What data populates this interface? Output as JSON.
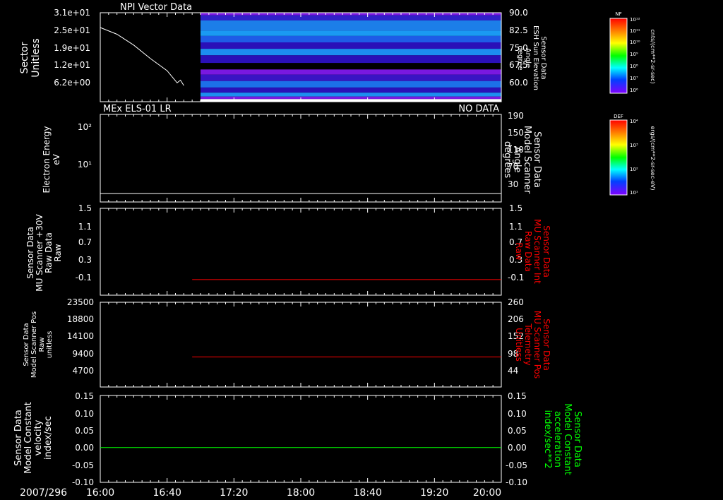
{
  "colors": {
    "background": "#000000",
    "frame": "#ffffff",
    "red": "#ff0000",
    "green": "#00ff00",
    "spectrogram_dark": "#2a10b8",
    "spectrogram_purple": "#7a18e0",
    "spectrogram_mid": "#1e46e6",
    "spectrogram_bright": "#1c8ef0"
  },
  "time_axis": {
    "date_label": "2007/296",
    "tick_labels": [
      "16:00",
      "16:40",
      "17:20",
      "18:00",
      "18:40",
      "19:20",
      "20:00"
    ]
  },
  "chart_data": [
    {
      "type": "line",
      "panel_title": "NPI Vector Data",
      "ylabel_lines": [
        "Sector",
        "Unitless"
      ],
      "right_label_lines": [
        "Sensor Data",
        "ESH Sun Elevation",
        "Angle",
        "degree"
      ],
      "y_tick_labels": [
        "3.1e+01",
        "2.5e+01",
        "1.9e+01",
        "1.2e+01",
        "6.2e+00"
      ],
      "right_tick_labels": [
        "90.0",
        "82.5",
        "75.0",
        "67.5",
        "60.0"
      ],
      "x": [
        "16:00",
        "16:10",
        "16:20",
        "16:30",
        "16:40",
        "16:46",
        "16:48",
        "16:50"
      ],
      "series": [
        {
          "values": [
            27.5,
            25.0,
            21.0,
            16.0,
            11.5,
            7.0,
            8.0,
            6.0
          ]
        }
      ],
      "overlay": {
        "type": "heatmap",
        "time_start": "17:00",
        "time_end": "20:00",
        "yrange_degrees": [
          55.5,
          90.0
        ]
      },
      "colorbar": {
        "label": "NF",
        "tick_labels": [
          "10¹²",
          "10¹¹",
          "10¹⁰",
          "10⁹",
          "10⁸",
          "10⁷",
          "10⁶"
        ],
        "unit": "cnts/(cm**2-sr-sec)"
      }
    },
    {
      "type": "line",
      "panel_title": "MEx ELS-01 LR",
      "status": "NO DATA",
      "ylabel_lines": [
        "Electron Energy",
        "eV"
      ],
      "right_label_lines": [
        "Sensor Data",
        "Model Scanner",
        "Angle",
        "degrees"
      ],
      "y_tick_labels": [
        "10²",
        "10¹"
      ],
      "right_tick_labels": [
        "190",
        "150",
        "110",
        "70",
        "30"
      ],
      "x": [
        "16:00",
        "20:00"
      ],
      "series": [
        {
          "values": [
            15,
            15
          ]
        }
      ],
      "ylim": [
        10,
        190
      ],
      "colorbar": {
        "label": "DEF",
        "tick_labels": [
          "10⁴",
          "10³",
          "10²",
          "10¹"
        ],
        "unit": "ergs/(cm**2-sr-sec-eV)"
      }
    },
    {
      "type": "line",
      "ylabel_lines": [
        "Sensor Data",
        "MU Scanner +30V",
        "Raw Data",
        "Raw"
      ],
      "right_label_lines": [
        "Sensor Data",
        "MU Scanner Int",
        "Raw Data",
        "Raw"
      ],
      "y_tick_labels": [
        "1.5",
        "1.1",
        "0.7",
        "0.3",
        "-0.1"
      ],
      "right_tick_labels": [
        "1.5",
        "1.1",
        "0.7",
        "0.3",
        "-0.1"
      ],
      "x": [
        "16:55",
        "20:00"
      ],
      "series": [
        {
          "values": [
            -0.1,
            -0.1
          ]
        }
      ],
      "ylim": [
        -0.45,
        1.5
      ]
    },
    {
      "type": "line",
      "ylabel_lines": [
        "Sensor Data",
        "Model Scanner Pos",
        "Raw",
        "unitless"
      ],
      "right_label_lines": [
        "Sensor Data",
        "MU Scanner Pos",
        "Telemetry",
        "Unitless"
      ],
      "y_tick_labels": [
        "23500",
        "18800",
        "14100",
        "9400",
        "4700"
      ],
      "right_tick_labels": [
        "260",
        "206",
        "152",
        "98",
        "44"
      ],
      "x": [
        "16:55",
        "20:00"
      ],
      "series": [
        {
          "values": [
            8350,
            8350
          ]
        }
      ],
      "ylim": [
        0,
        23500
      ]
    },
    {
      "type": "line",
      "ylabel_lines": [
        "Sensor Data",
        "Model Constant",
        "velocity",
        "index/sec"
      ],
      "right_label_lines": [
        "Sensor Data",
        "Model Constant",
        "acceleration",
        "index/sec**2"
      ],
      "y_tick_labels": [
        "0.15",
        "0.10",
        "0.05",
        "0.00",
        "-0.05",
        "-0.10"
      ],
      "right_tick_labels": [
        "0.15",
        "0.10",
        "0.05",
        "0.00",
        "-0.05",
        "-0.10"
      ],
      "x": [
        "16:00",
        "20:00"
      ],
      "series": [
        {
          "values": [
            0.0,
            0.0
          ]
        }
      ],
      "ylim": [
        -0.1,
        0.15
      ]
    }
  ]
}
